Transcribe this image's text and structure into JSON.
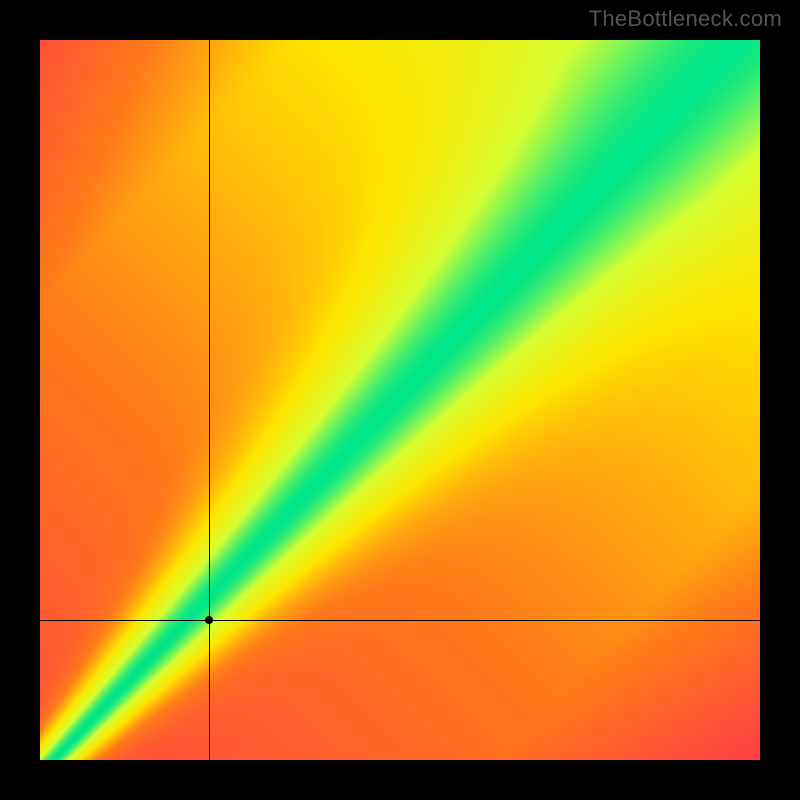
{
  "watermark": "TheBottleneck.com",
  "chart_data": {
    "type": "heatmap",
    "title": "",
    "xlabel": "",
    "ylabel": "",
    "xlim": [
      0,
      1
    ],
    "ylim": [
      0,
      1
    ],
    "colorscale": {
      "description": "red→orange→yellow→green diverging; green along diagonal ridge",
      "stops": [
        {
          "t": 0.0,
          "color": "#ff2a55"
        },
        {
          "t": 0.35,
          "color": "#ff7a1a"
        },
        {
          "t": 0.6,
          "color": "#ffe600"
        },
        {
          "t": 0.82,
          "color": "#d6ff33"
        },
        {
          "t": 1.0,
          "color": "#00e68a"
        }
      ]
    },
    "ridge": {
      "description": "Green optimal band runs roughly along y ≈ x (slightly sublinear near origin, widening toward top-right). Value z at pixel computed from perpendicular distance to this ridge plus a radial gradient.",
      "slope": 1.05,
      "intercept": -0.02,
      "band_half_width_at_0": 0.02,
      "band_half_width_at_1": 0.12
    },
    "crosshair": {
      "x": 0.235,
      "y": 0.195
    },
    "marker": {
      "x": 0.235,
      "y": 0.195
    }
  }
}
